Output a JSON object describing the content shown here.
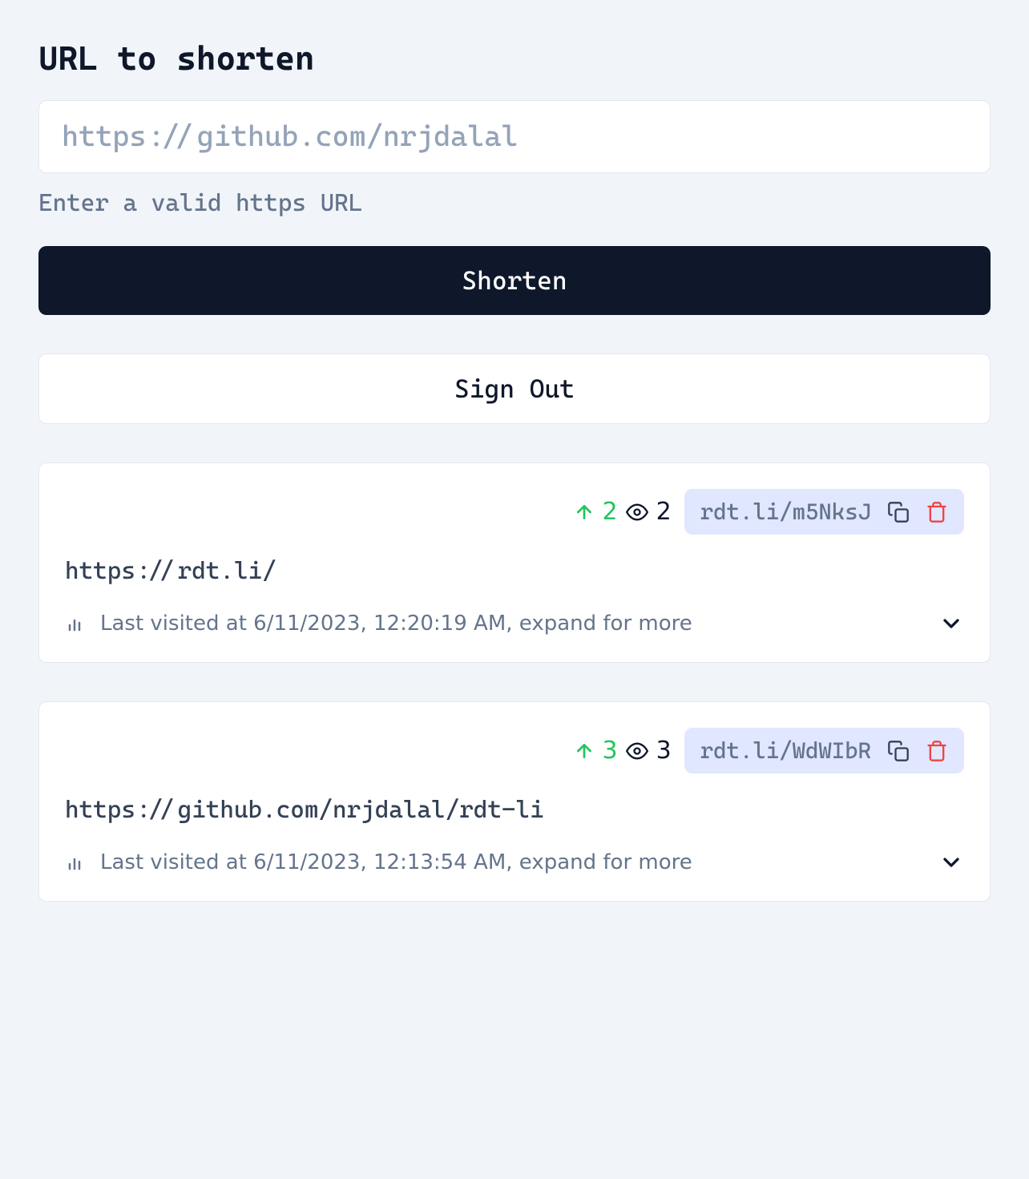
{
  "form": {
    "title": "URL to shorten",
    "placeholder": "https://github.com/nrjdalal",
    "helper_text": "Enter a valid https URL",
    "submit_label": "Shorten",
    "signout_label": "Sign Out"
  },
  "links": [
    {
      "unique_visits": "2",
      "total_views": "2",
      "short_url": "rdt.li/m5NksJ",
      "original_url": "https://rdt.li/",
      "visit_info": "Last visited at 6/11/2023, 12:20:19 AM, expand for more"
    },
    {
      "unique_visits": "3",
      "total_views": "3",
      "short_url": "rdt.li/WdWIbR",
      "original_url": "https://github.com/nrjdalal/rdt-li",
      "visit_info": "Last visited at 6/11/2023, 12:13:54 AM, expand for more"
    }
  ]
}
